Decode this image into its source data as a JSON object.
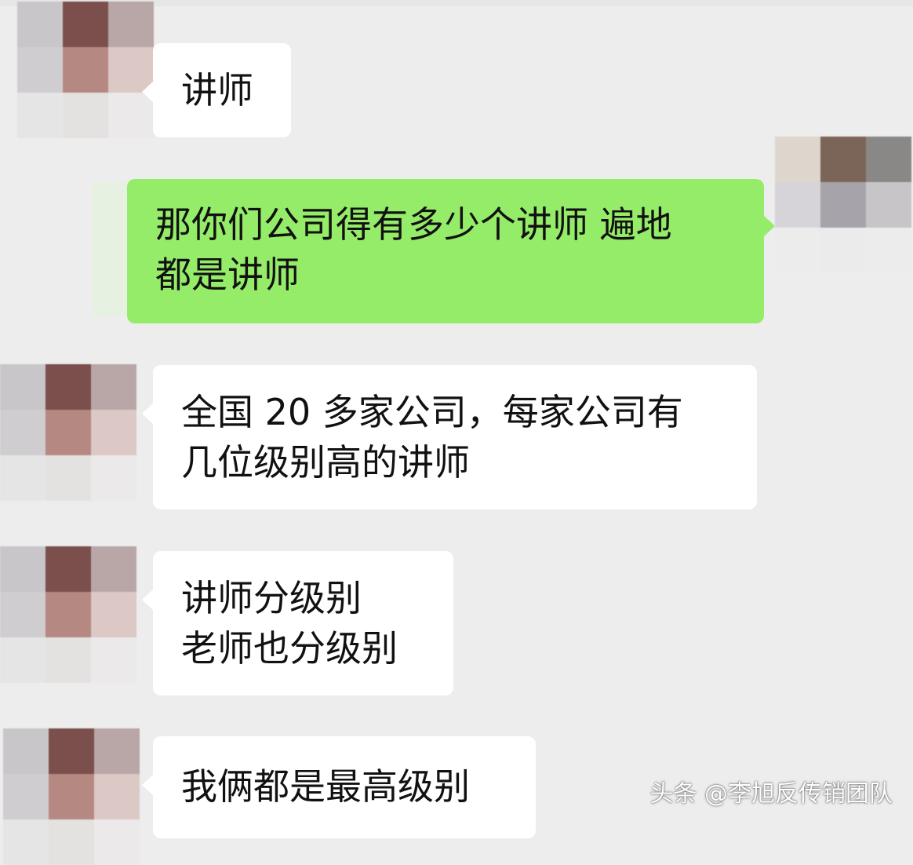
{
  "messages": [
    {
      "side": "in",
      "lines": [
        "讲师"
      ]
    },
    {
      "side": "out",
      "lines": [
        "那你们公司得有多少个讲师 遍地",
        "都是讲师"
      ]
    },
    {
      "side": "in",
      "lines": [
        "全国 20 多家公司，每家公司有",
        "几位级别高的讲师"
      ]
    },
    {
      "side": "in",
      "lines": [
        "讲师分级别",
        "老师也分级别"
      ]
    },
    {
      "side": "in",
      "lines": [
        "我俩都是最高级别"
      ]
    }
  ],
  "watermark": "头条 @李旭反传销团队",
  "avatars": {
    "in": [
      "#c8c6c8",
      "#7a4f4c",
      "#b9a6a6",
      "#d0cdd0",
      "#b68882",
      "#dcc8c4",
      "#e6e5e6",
      "#e4e1e1",
      "#ebe9e9"
    ],
    "out": [
      "#ddd6cd",
      "#7b6558",
      "#8a8787",
      "#d6d4d8",
      "#a6a4aa",
      "#c7c5c8",
      "#ececec",
      "#ebebeb",
      "#ececec"
    ]
  },
  "colors": {
    "background": "#ededed",
    "bubble_in": "#ffffff",
    "bubble_out": "#95ec69",
    "text": "#111111"
  }
}
